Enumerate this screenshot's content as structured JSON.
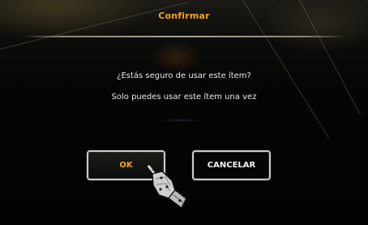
{
  "dialog": {
    "title": "Confirmar",
    "message_line1": "¿Estás seguro de usar este ítem?",
    "message_line2": "Solo puedes usar este ítem una vez",
    "ok_label": "OK",
    "cancel_label": "CANCELAR"
  },
  "colors": {
    "title": "#f0a51e",
    "ok_text": "#f0a51e",
    "cancel_text": "#f2f2f2",
    "message_text": "#e8e8e8",
    "button_border": "#c9c9c9",
    "background": "#050505"
  },
  "cursor": {
    "icon": "gauntlet-pointer-icon"
  }
}
